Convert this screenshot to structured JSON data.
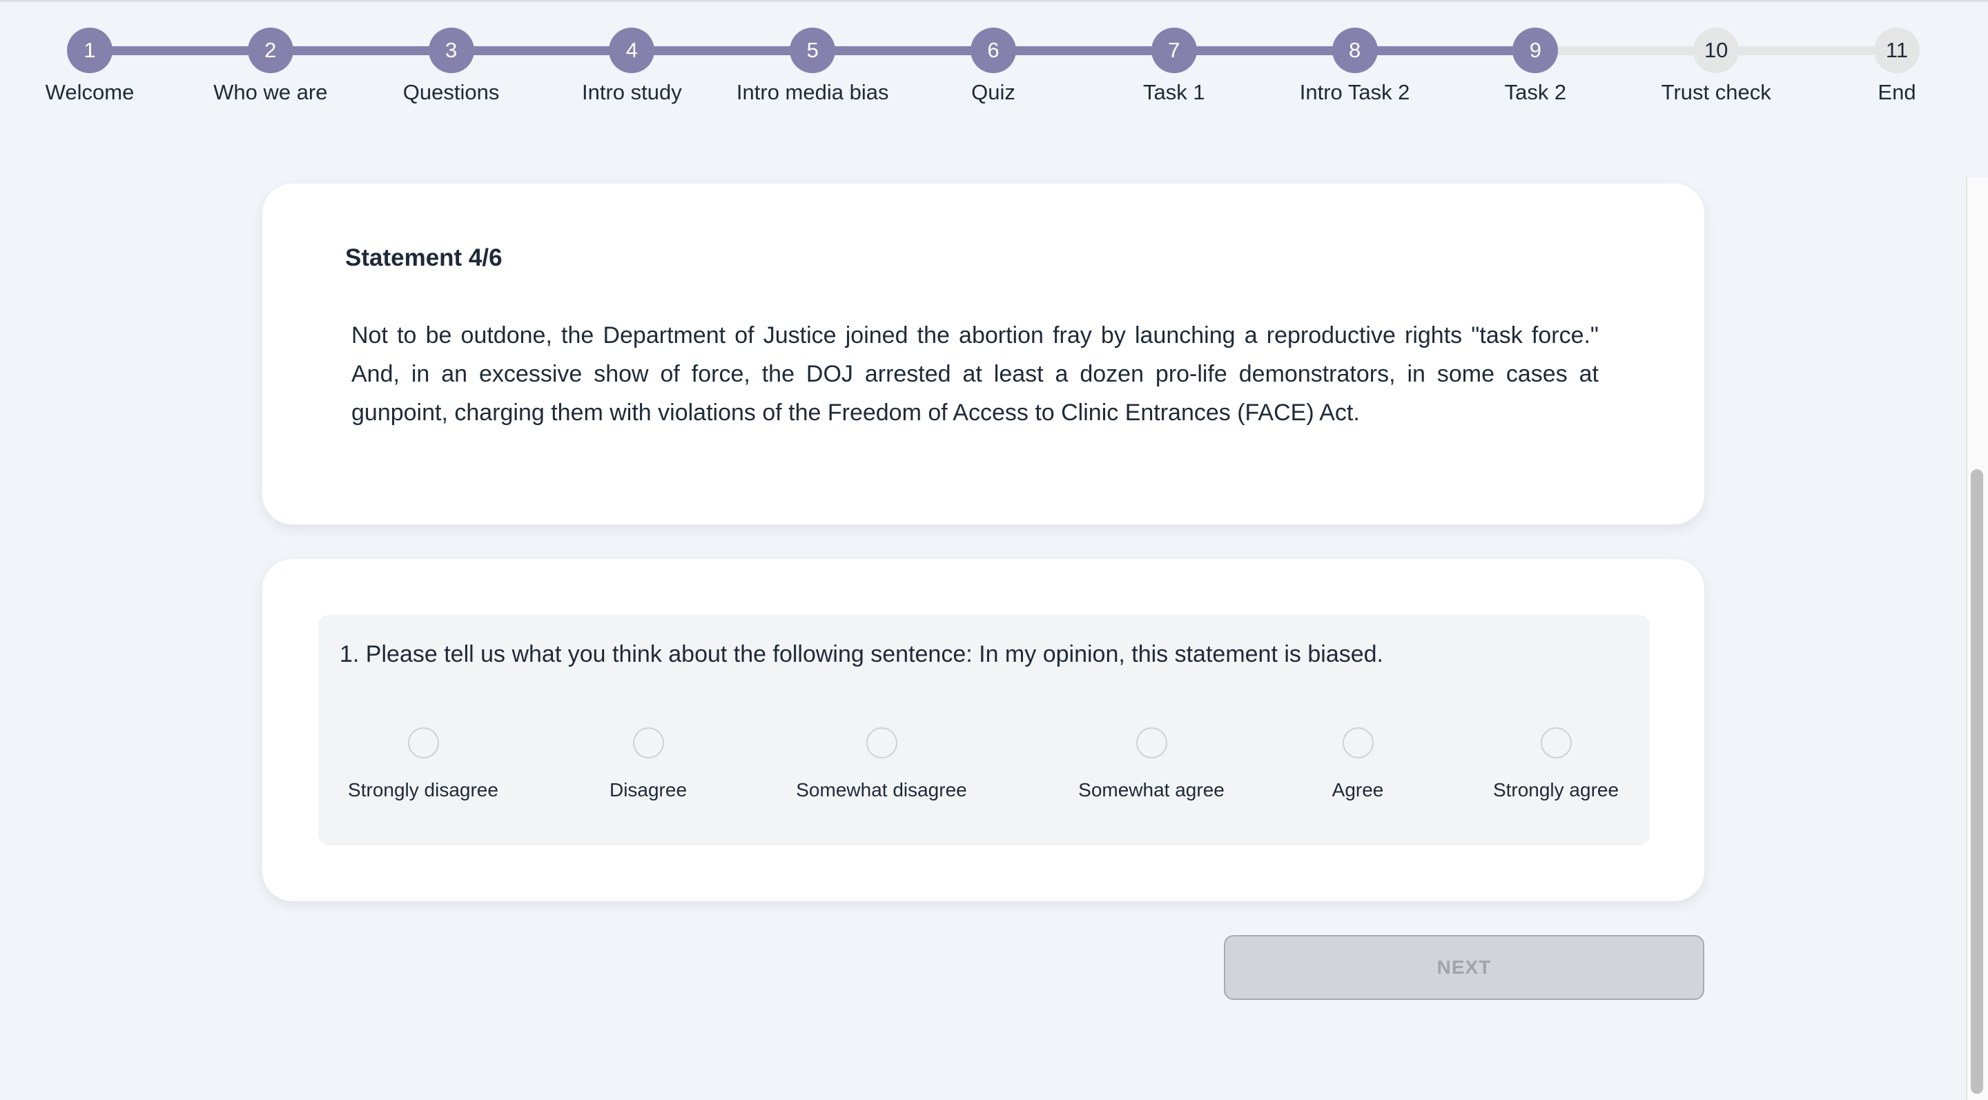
{
  "colors": {
    "active": "#8581ad",
    "inactive": "#e4e6e5",
    "background": "#f1f4f9"
  },
  "stepper": {
    "current_step": 9,
    "steps": [
      {
        "number": "1",
        "label": "Welcome"
      },
      {
        "number": "2",
        "label": "Who we are"
      },
      {
        "number": "3",
        "label": "Questions"
      },
      {
        "number": "4",
        "label": "Intro study"
      },
      {
        "number": "5",
        "label": "Intro media bias"
      },
      {
        "number": "6",
        "label": "Quiz"
      },
      {
        "number": "7",
        "label": "Task 1"
      },
      {
        "number": "8",
        "label": "Intro Task 2"
      },
      {
        "number": "9",
        "label": "Task 2"
      },
      {
        "number": "10",
        "label": "Trust check"
      },
      {
        "number": "11",
        "label": "End"
      }
    ]
  },
  "statement": {
    "title": "Statement 4/6",
    "text": "Not to be outdone, the Department of Justice joined the abortion fray by launching a reproductive rights \"task force.\" And, in an excessive show of force, the DOJ arrested at least a dozen pro-life demonstrators, in some cases at gunpoint, charging them with violations of the Freedom of Access to Clinic Entrances (FACE) Act."
  },
  "question": {
    "text": "1. Please tell us what you think about the following sentence: In my opinion, this statement is biased.",
    "options": [
      "Strongly disagree",
      "Disagree",
      "Somewhat disagree",
      "Somewhat agree",
      "Agree",
      "Strongly agree"
    ],
    "selected": null
  },
  "next_button": {
    "label": "NEXT",
    "disabled": true
  }
}
